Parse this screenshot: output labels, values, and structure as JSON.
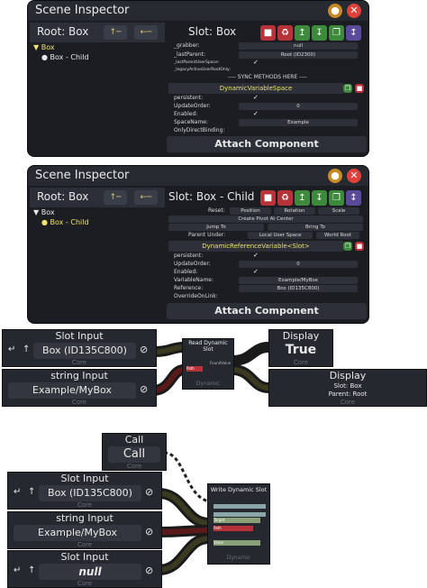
{
  "inspector1": {
    "title": "Scene Inspector",
    "root_label": "Root: Box",
    "slot_label": "Slot: Box",
    "tree": [
      "Box",
      "Box - Child"
    ],
    "fields": [
      {
        "label": "_grabber:",
        "value": "null"
      },
      {
        "label": "_lastParent:",
        "value": "Root (ID2300)"
      },
      {
        "label": "_lastParentUserSpace:",
        "value": ""
      },
      {
        "label": "_legacyActiveUserRootOnly:",
        "value": ""
      }
    ],
    "sync_text": "---- SYNC METHODS HERE ----",
    "component": "DynamicVariableSpace",
    "comp_fields": [
      {
        "label": "persistent:",
        "value": ""
      },
      {
        "label": "UpdateOrder:",
        "value": "0"
      },
      {
        "label": "Enabled:",
        "value": ""
      },
      {
        "label": "SpaceName:",
        "value": "Example"
      },
      {
        "label": "OnlyDirectBinding:",
        "value": ""
      }
    ],
    "attach": "Attach Component"
  },
  "inspector2": {
    "title": "Scene Inspector",
    "root_label": "Root: Box",
    "slot_label": "Slot: Box - Child",
    "tree": [
      "Box",
      "Box - Child"
    ],
    "reset_label": "Reset:",
    "reset_buttons": [
      "Position",
      "Rotation",
      "Scale"
    ],
    "pivot_button": "Create Pivot At Center",
    "jump_to": "Jump To",
    "bring_to": "Bring To",
    "parent_under_label": "Parent Under:",
    "parent_buttons": [
      "Local User Space",
      "World Root"
    ],
    "component": "DynamicReferenceVariable<Slot>",
    "comp_fields": [
      {
        "label": "persistent:",
        "value": ""
      },
      {
        "label": "UpdateOrder:",
        "value": "0"
      },
      {
        "label": "Enabled:",
        "value": ""
      },
      {
        "label": "VariableName:",
        "value": "Example/MyBox"
      },
      {
        "label": "Reference:",
        "value": "Box (ID135C800)"
      },
      {
        "label": "OverrideOnLink:",
        "value": ""
      }
    ],
    "attach": "Attach Component"
  },
  "graph1": {
    "slot_input_title": "Slot Input",
    "slot_input_value": "Box (ID135C800)",
    "string_input_title": "string Input",
    "string_input_value": "Example/MyBox",
    "read_node_title": "Read Dynamic Slot",
    "read_node_footer": "Dynamic",
    "read_ports": [
      "FoundValue",
      "Path"
    ],
    "display1_title": "Display",
    "display1_value": "True",
    "display2_title": "Display",
    "display2_lines": [
      "Slot: Box",
      "Parent: Root"
    ],
    "core": "Core"
  },
  "graph2": {
    "call_title": "Call",
    "call_value": "Call",
    "slot_input_title": "Slot Input",
    "slot_input_value": "Box (ID135C800)",
    "string_input_title": "string Input",
    "string_input_value": "Example/MyBox",
    "slot_input2_title": "Slot Input",
    "slot_input2_value": "null",
    "write_node_title": "Write Dynamic Slot",
    "write_node_footer": "Dynamic",
    "write_ports": [
      "Target",
      "Path",
      "Value"
    ],
    "core": "Core"
  }
}
